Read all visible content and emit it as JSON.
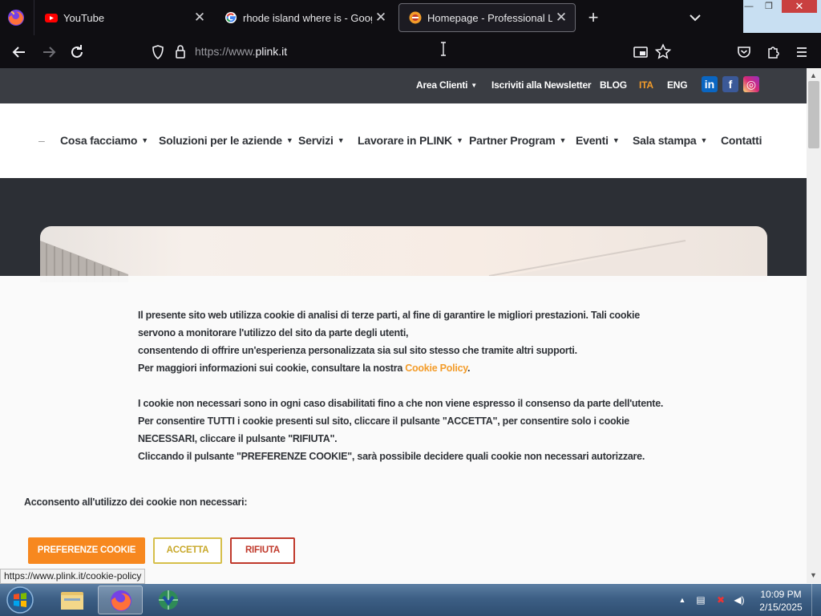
{
  "browser": {
    "tabs": [
      {
        "title": "YouTube",
        "icon": "youtube-icon",
        "active": false
      },
      {
        "title": "rhode island where is - Google",
        "icon": "google-icon",
        "active": false
      },
      {
        "title": "Homepage - Professional Link",
        "icon": "plink-favicon",
        "active": true
      }
    ],
    "close_glyph": "✕",
    "new_tab_glyph": "+",
    "url_prefix": "https://www.",
    "url_domain": "plink.it"
  },
  "site": {
    "topbar": {
      "area_clienti": "Area Clienti",
      "newsletter": "Iscriviti alla Newsletter",
      "blog": "BLOG",
      "ita": "ITA",
      "eng": "ENG",
      "accent_color": "#f39c2a"
    },
    "social": [
      {
        "name": "linkedin",
        "glyph": "in",
        "color": "#0a66c2"
      },
      {
        "name": "facebook",
        "glyph": "f",
        "color": "#3b5998"
      },
      {
        "name": "instagram",
        "glyph": "◎",
        "color": "#d6249f"
      }
    ],
    "menu": [
      {
        "label": "Cosa facciamo",
        "dropdown": true
      },
      {
        "label": "Soluzioni per le aziende",
        "dropdown": true
      },
      {
        "label": "Servizi",
        "dropdown": true
      },
      {
        "label": "Lavorare in PLINK",
        "dropdown": true
      },
      {
        "label": "Partner Program",
        "dropdown": true
      },
      {
        "label": "Eventi",
        "dropdown": true
      },
      {
        "label": "Sala stampa",
        "dropdown": true
      },
      {
        "label": "Contatti",
        "dropdown": false
      }
    ],
    "menu_dash": "–"
  },
  "cookie": {
    "p1": "Il presente sito web utilizza cookie di analisi di terze parti, al fine di garantire le migliori prestazioni. Tali cookie servono a monitorare l'utilizzo del sito da parte degli utenti,",
    "p2": "consentendo di offrire un'esperienza personalizzata sia sul sito stesso che tramite altri supporti.",
    "p3_before": "Per maggiori informazioni sui cookie, consultare la nostra ",
    "p3_link": "Cookie Policy",
    "p3_after": ".",
    "p4": "I cookie non necessari sono in ogni caso disabilitati fino a che non viene espresso il consenso da parte dell'utente.",
    "p5": "Per consentire TUTTI i cookie presenti sul sito, cliccare il pulsante \"ACCETTA\", per consentire solo i cookie NECESSARI, cliccare il pulsante \"RIFIUTA\".",
    "p6": "Cliccando il pulsante \"PREFERENZE COOKIE\", sarà possibile decidere quali cookie non necessari autorizzare.",
    "consent_label": "Acconsento all'utilizzo dei cookie non necessari:",
    "buttons": {
      "preferences": "PREFERENZE COOKIE",
      "accept": "ACCETTA",
      "reject": "RIFIUTA"
    }
  },
  "status_url": "https://www.plink.it/cookie-policy",
  "taskbar": {
    "time": "10:09 PM",
    "date": "2/15/2025",
    "tray_up": "▲"
  }
}
